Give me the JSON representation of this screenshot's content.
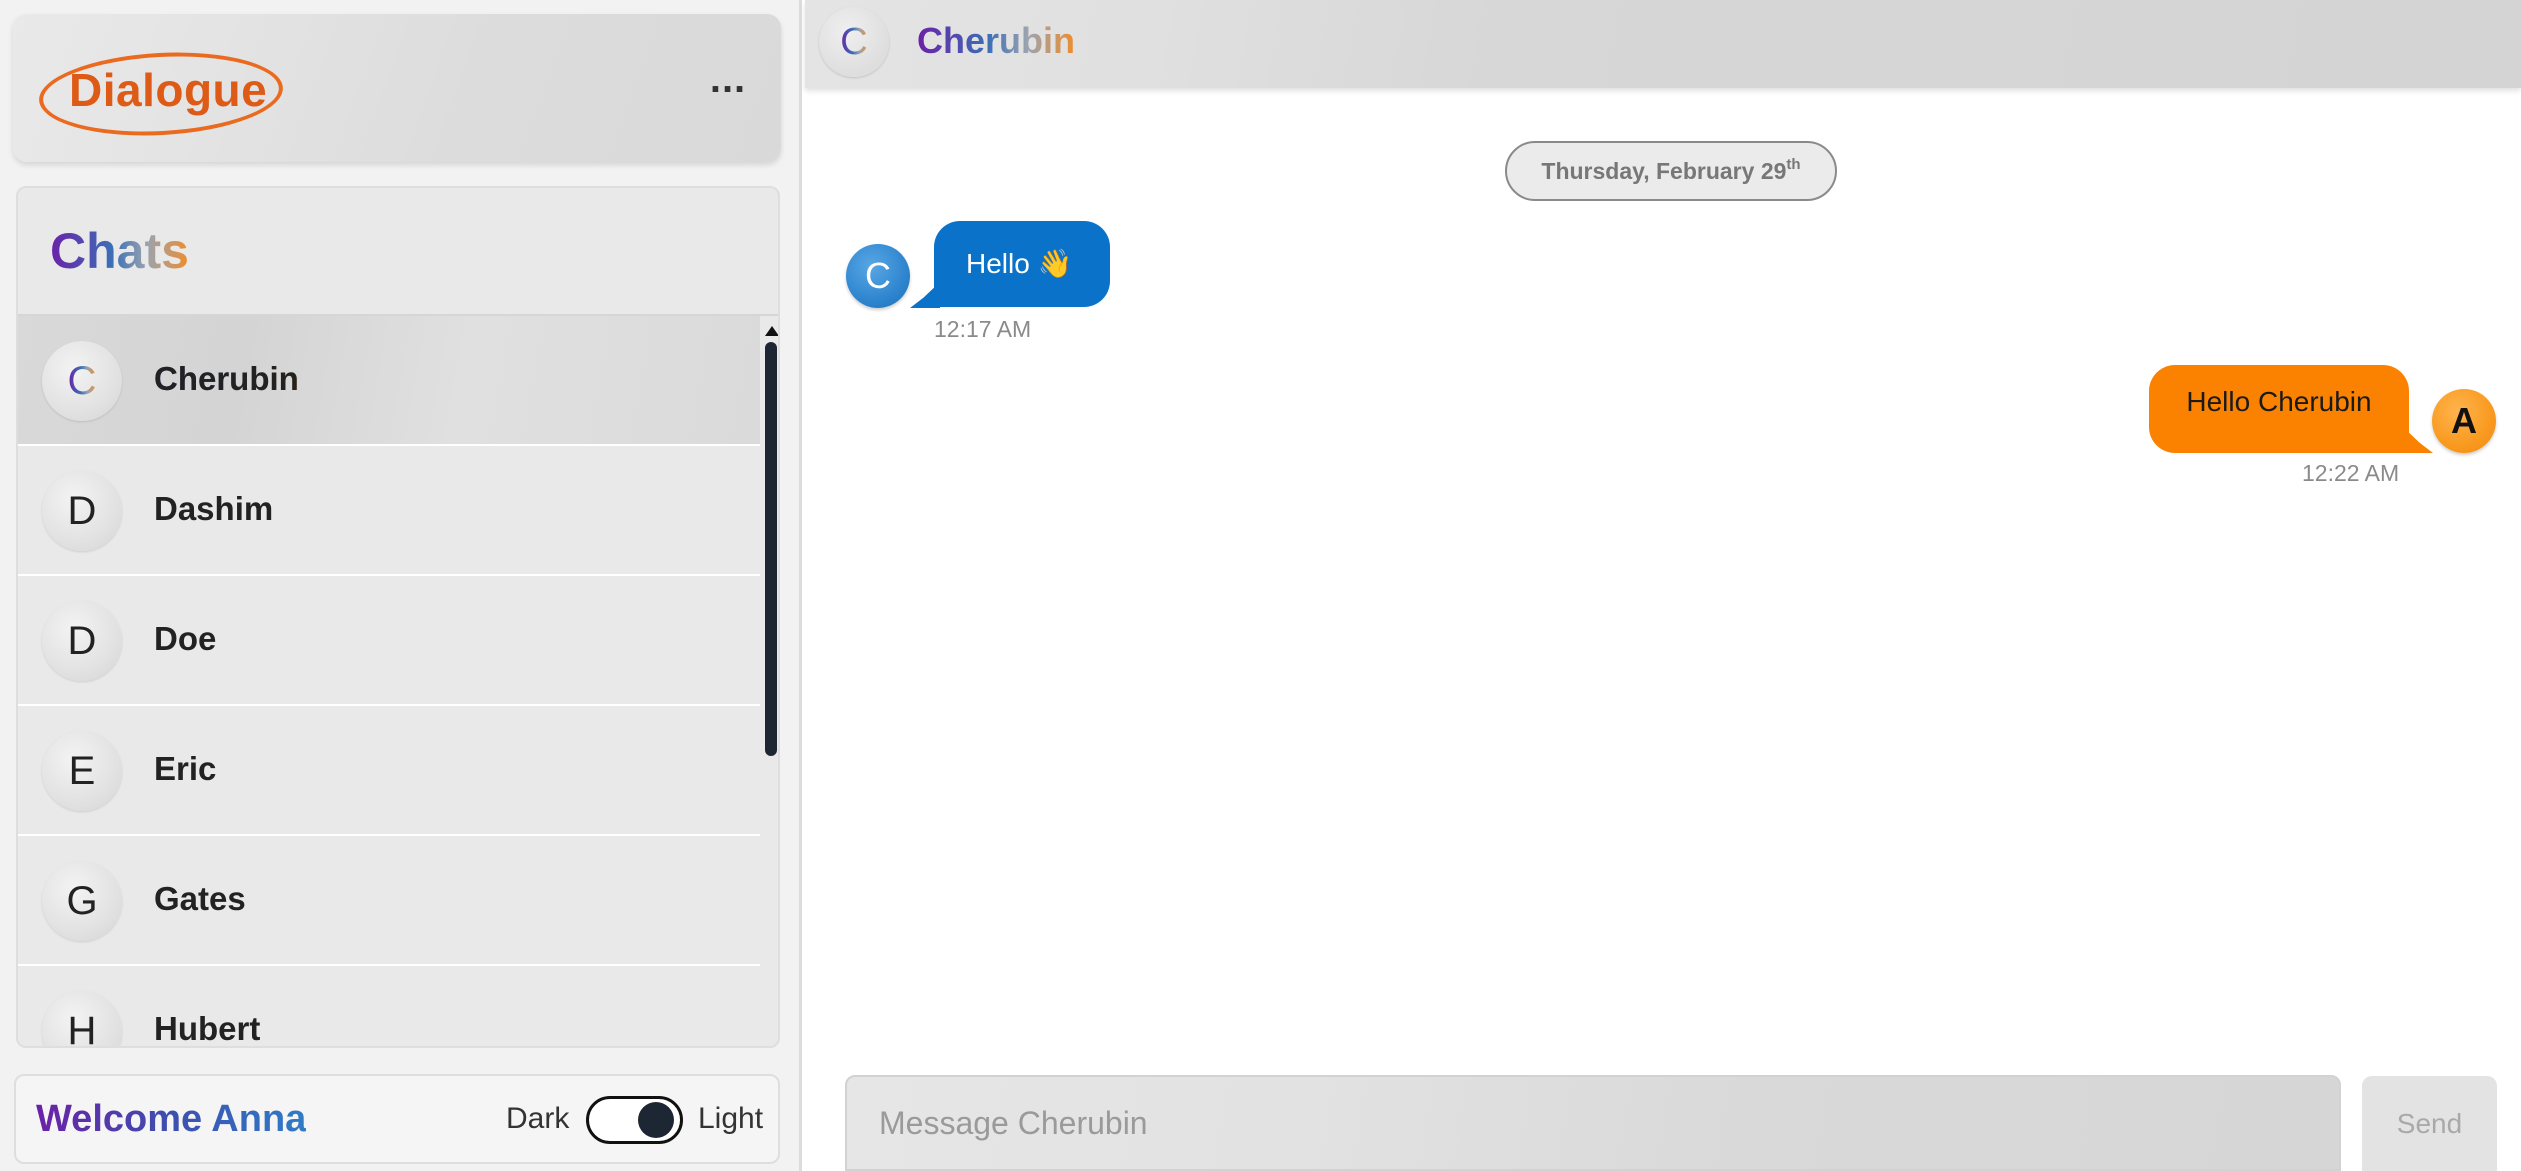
{
  "app": {
    "logo_text": "Dialogue",
    "more_menu_label": "..."
  },
  "sidebar": {
    "title": "Chats",
    "contacts": [
      {
        "initial": "C",
        "name": "Cherubin",
        "active": true
      },
      {
        "initial": "D",
        "name": "Dashim",
        "active": false
      },
      {
        "initial": "D",
        "name": "Doe",
        "active": false
      },
      {
        "initial": "E",
        "name": "Eric",
        "active": false
      },
      {
        "initial": "G",
        "name": "Gates",
        "active": false
      },
      {
        "initial": "H",
        "name": "Hubert",
        "active": false
      }
    ],
    "footer": {
      "welcome": "Welcome Anna",
      "theme_dark_label": "Dark",
      "theme_light_label": "Light",
      "theme": "dark"
    }
  },
  "chat": {
    "header": {
      "initial": "C",
      "name": "Cherubin"
    },
    "date_divider": {
      "text": "Thursday, February 29",
      "suffix": "th"
    },
    "messages": [
      {
        "direction": "incoming",
        "avatar": "C",
        "text": "Hello 👋",
        "time": "12:17 AM"
      },
      {
        "direction": "outgoing",
        "avatar": "A",
        "text": "Hello Cherubin",
        "time": "12:22 AM"
      }
    ],
    "composer": {
      "placeholder": "Message Cherubin",
      "send_label": "Send"
    }
  },
  "colors": {
    "incoming_bubble": "#0a73c9",
    "outgoing_bubble": "#fb8200",
    "logo": "#dd5b16"
  }
}
